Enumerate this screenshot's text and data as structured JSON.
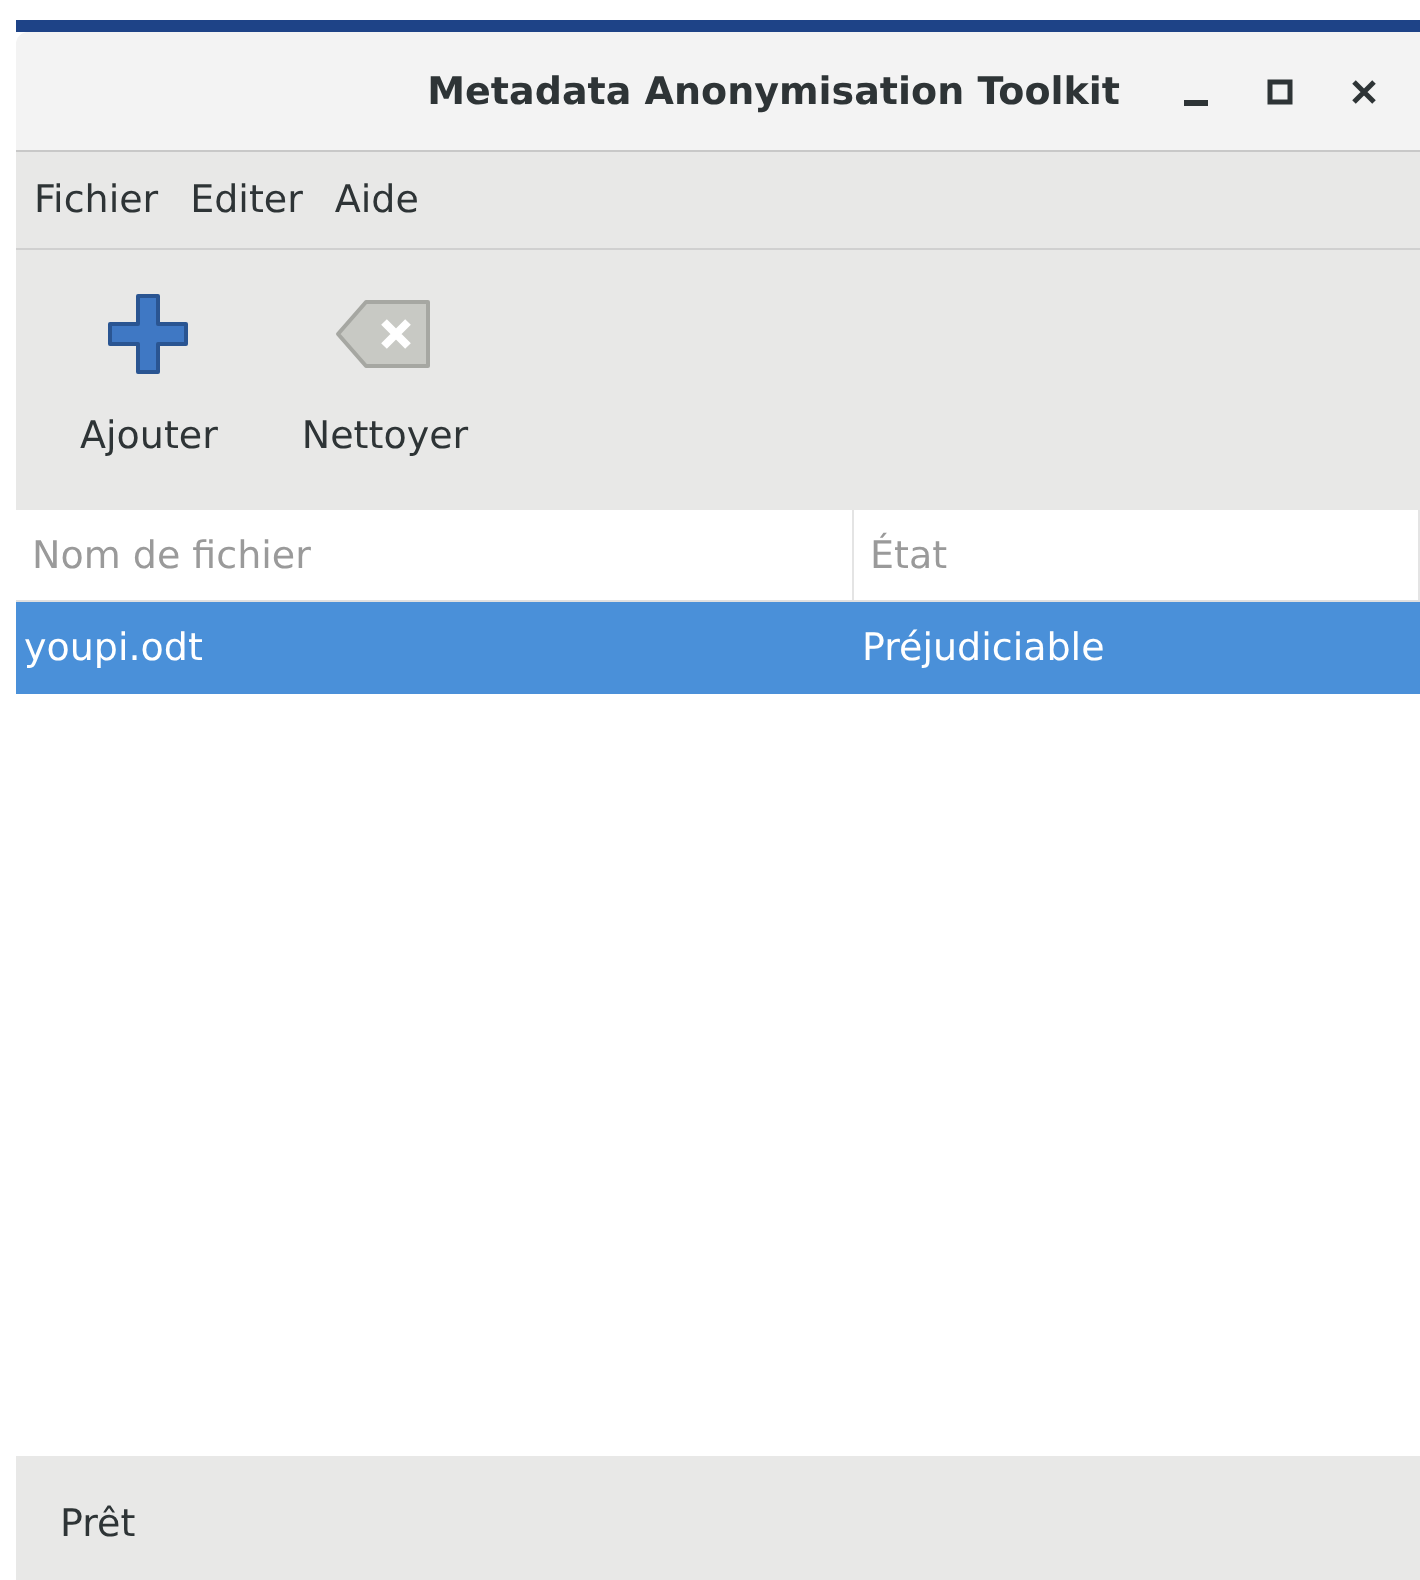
{
  "window": {
    "title": "Metadata Anonymisation Toolkit"
  },
  "menu": [
    "Fichier",
    "Editer",
    "Aide"
  ],
  "toolbar": [
    {
      "kind": "add",
      "label": "Ajouter"
    },
    {
      "kind": "clear",
      "label": "Nettoyer"
    }
  ],
  "table": {
    "columns": [
      "Nom de fichier",
      "État"
    ],
    "rows": [
      {
        "cells": [
          "youpi.odt",
          "Préjudiciable"
        ],
        "selected": true
      }
    ]
  },
  "status_bar": "Prêt"
}
